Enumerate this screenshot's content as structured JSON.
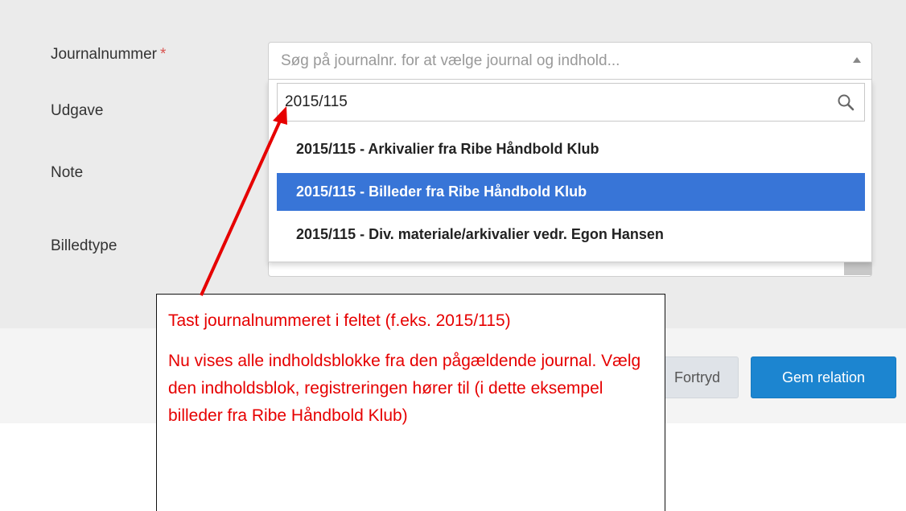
{
  "form": {
    "labels": {
      "journalnummer": "Journalnummer",
      "required_marker": "*",
      "udgave": "Udgave",
      "note": "Note",
      "billedtype": "Billedtype"
    },
    "journal_select": {
      "placeholder": "Søg på journalnr. for at vælge journal og indhold..."
    },
    "dropdown": {
      "search_value": "2015/115",
      "options": [
        {
          "label": "2015/115 - Arkivalier fra Ribe Håndbold Klub",
          "highlighted": false
        },
        {
          "label": "2015/115 - Billeder fra Ribe Håndbold Klub",
          "highlighted": true
        },
        {
          "label": "2015/115 - Div. materiale/arkivalier vedr. Egon Hansen",
          "highlighted": false
        }
      ]
    }
  },
  "footer": {
    "cancel_label": "Fortryd",
    "save_label": "Gem relation"
  },
  "annotation": {
    "line1": "Tast journalnummeret i feltet (f.eks. 2015/115)",
    "line2": "Nu vises alle indholdsblokke fra den pågældende journal. Vælg den indholdsblok, registreringen hører til (i dette eksempel billeder fra Ribe Håndbold Klub)"
  },
  "colors": {
    "highlight": "#3875d7",
    "primary_button": "#1c85d0",
    "annotation_text": "#e60000",
    "arrow": "#e60000"
  }
}
